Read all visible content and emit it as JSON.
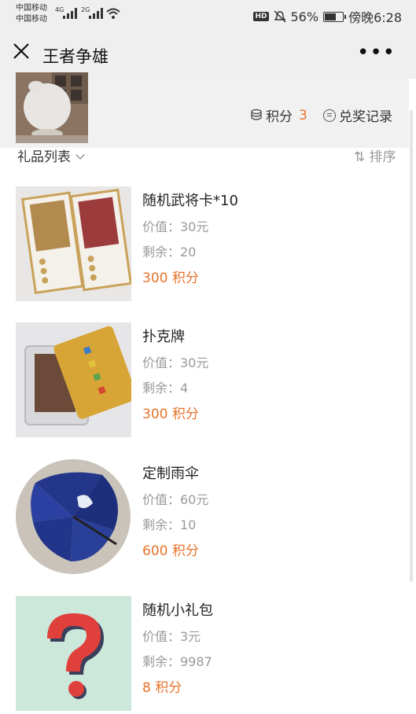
{
  "status_bar": {
    "carrier1": "中国移动",
    "carrier2": "中国移动",
    "network1": "4G",
    "network2": "2G",
    "hd": "HD",
    "battery": "56%",
    "battery_level": 0.56,
    "time": "傍晚6:28"
  },
  "nav": {
    "title": "王者争雄",
    "more": "•••"
  },
  "points": {
    "label": "积分",
    "value": "3"
  },
  "record": {
    "label": "兑奖记录"
  },
  "list": {
    "header": "礼品列表",
    "sort": "⇅ 排序"
  },
  "items": [
    {
      "name": "随机武将卡*10",
      "value": "价值：30元",
      "stock": "剩余：20",
      "points": "300 积分"
    },
    {
      "name": "扑克牌",
      "value": "价值：30元",
      "stock": "剩余：4",
      "points": "300 积分"
    },
    {
      "name": "定制雨伞",
      "value": "价值：60元",
      "stock": "剩余：10",
      "points": "600 积分"
    },
    {
      "name": "随机小礼包",
      "value": "价值：3元",
      "stock": "剩余：9987",
      "points": "8 积分"
    }
  ],
  "colors": {
    "accent": "#e8722a",
    "muted": "#999999",
    "bar_bg": "#efefef"
  }
}
